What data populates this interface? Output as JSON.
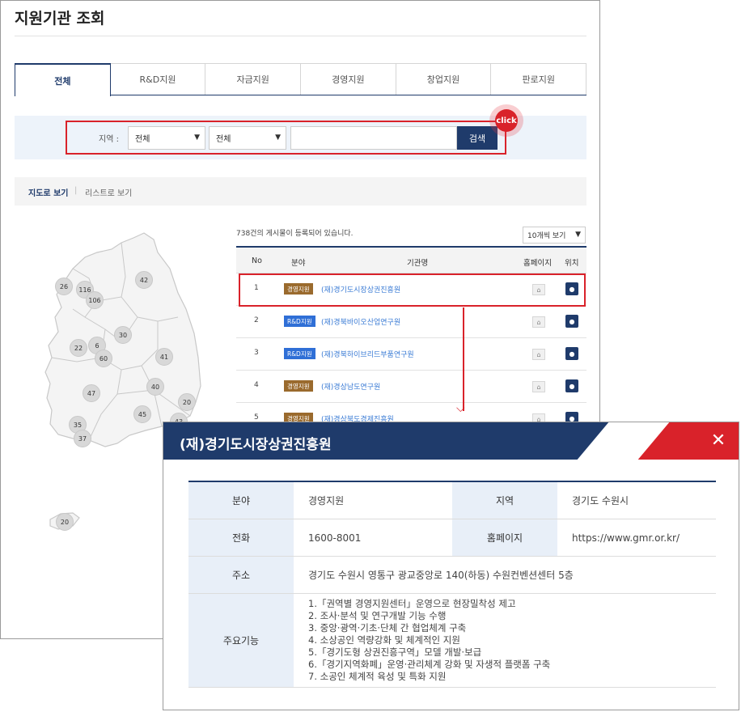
{
  "page": {
    "title": "지원기관 조회",
    "tabs": [
      "전체",
      "R&D지원",
      "자금지원",
      "경영지원",
      "창업지원",
      "판로지원"
    ]
  },
  "search": {
    "region_label": "지역 :",
    "region1": "전체",
    "region2": "전체",
    "keyword": "",
    "button": "검색",
    "click_marker": "click"
  },
  "view": {
    "map": "지도로 보기",
    "separator": "|",
    "list": "리스트로 보기"
  },
  "map": {
    "counts": [
      "26",
      "116",
      "106",
      "42",
      "30",
      "22",
      "6",
      "60",
      "41",
      "47",
      "40",
      "20",
      "45",
      "43",
      "35",
      "37",
      "20"
    ]
  },
  "list": {
    "count_text": "738건의 게시물이 등록되어 있습니다.",
    "per_page": "10개씩 보기",
    "headers": [
      "No",
      "분야",
      "기관명",
      "홈페이지",
      "위치"
    ],
    "rows": [
      {
        "no": "1",
        "field": "경영지원",
        "org": "(재)경기도시장상권진흥원"
      },
      {
        "no": "2",
        "field": "R&D지원",
        "org": "(재)경북바이오산업연구원"
      },
      {
        "no": "3",
        "field": "R&D지원",
        "org": "(재)경북하이브리드부품연구원"
      },
      {
        "no": "4",
        "field": "경영지원",
        "org": "(재)경상남도연구원"
      },
      {
        "no": "5",
        "field": "경영지원",
        "org": "(재)경상북도경제진흥원"
      }
    ]
  },
  "popup": {
    "title": "(재)경기도시장상권진흥원",
    "fields": {
      "field_label": "분야",
      "field_value": "경영지원",
      "region_label": "지역",
      "region_value": "경기도 수원시",
      "phone_label": "전화",
      "phone_value": "1600-8001",
      "homepage_label": "홈페이지",
      "homepage_value": "https://www.gmr.or.kr/",
      "address_label": "주소",
      "address_value": "경기도 수원시 영통구 광교중앙로 140(하동) 수원컨벤션센터 5층",
      "functions_label": "주요기능"
    },
    "functions": [
      "1.「권역별 경영지원센터」운영으로 현장밀착성 제고",
      "2. 조사·분석 및 연구개발 기능 수행",
      "3. 중앙·광역·기초·단체 간 협업체계 구축",
      "4. 소상공인 역량강화 및 체계적인 지원",
      "5.「경기도형 상권진흥구역」모델 개발·보급",
      "6.「경기지역화폐」운영·관리체계 강화 및 자생적 플랫폼 구축",
      "7. 소공인 체계적 육성 및 특화 지원"
    ]
  },
  "colors": {
    "navy": "#1f3b6b",
    "red": "#d9222a",
    "badge_mgmt": "#9a6a2d",
    "badge_rnd": "#2f6fd6",
    "link": "#3a7bd5"
  },
  "icons": [
    "chevron-down-icon",
    "home-icon",
    "location-pin-icon",
    "close-icon",
    "arrow-down-icon"
  ]
}
